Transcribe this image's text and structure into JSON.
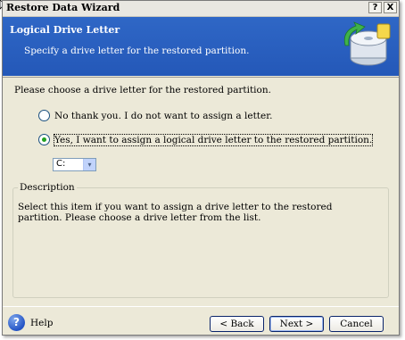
{
  "window": {
    "title": "Restore Data Wizard",
    "help_btn": "?",
    "close_btn": "X"
  },
  "header": {
    "title": "Logical Drive Letter",
    "subtitle": "Specify a drive letter for the restored partition."
  },
  "content": {
    "prompt": "Please choose a drive letter for the restored partition.",
    "options": [
      {
        "label": "No thank you. I do not want to assign a letter.",
        "selected": false
      },
      {
        "label": "Yes, I want to assign a logical drive letter to the restored partition.",
        "selected": true
      }
    ],
    "drive_select": {
      "value": "C:",
      "arrow": "▾"
    },
    "description": {
      "legend": "Description",
      "text": "Select this item if you want to assign a drive letter to the restored partition. Please choose a drive letter from the list."
    }
  },
  "footer": {
    "help_icon": "?",
    "help": "Help",
    "back": "< Back",
    "next": "Next >",
    "cancel": "Cancel"
  },
  "colors": {
    "header_bg": "#2f67c6",
    "window_bg": "#ece9d8",
    "radio_selected": "#21a121"
  }
}
